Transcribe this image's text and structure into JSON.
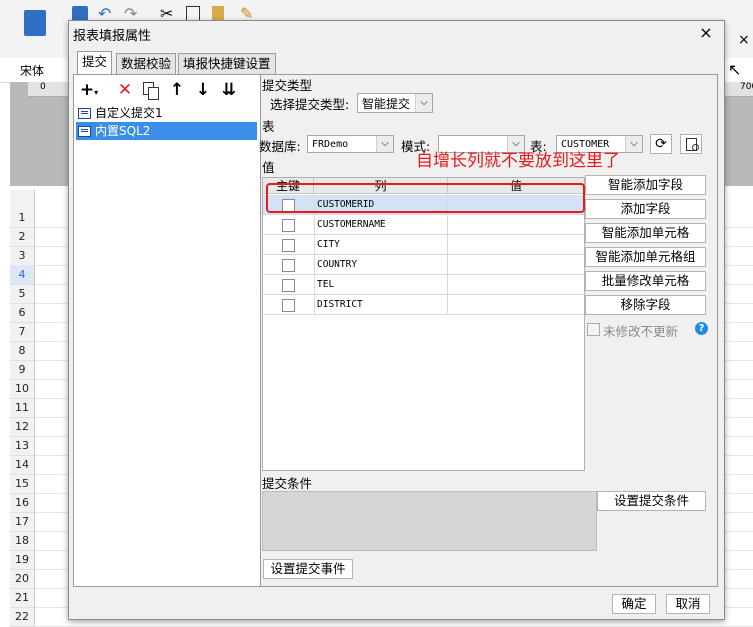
{
  "app": {
    "font_name": "宋体",
    "ruler_marks": [
      "0",
      "700"
    ],
    "row_numbers": [
      "1",
      "2",
      "3",
      "4",
      "5",
      "6",
      "7",
      "8",
      "9",
      "10",
      "11",
      "12",
      "13",
      "14",
      "15",
      "16",
      "17",
      "18",
      "19",
      "20",
      "21",
      "22"
    ],
    "selected_row": "4",
    "right_close_x": "×"
  },
  "dialog": {
    "title": "报表填报属性",
    "close_icon": "×",
    "tabs": [
      "提交",
      "数据校验",
      "填报快捷键设置"
    ],
    "active_tab": "提交",
    "left": {
      "tools": [
        "+",
        "×",
        "copy",
        "↑",
        "↓",
        "move-bottom"
      ],
      "items": [
        "自定义提交1",
        "内置SQL2"
      ],
      "selected_item": "内置SQL2"
    },
    "submit_type": {
      "section_label": "提交类型",
      "select_label": "选择提交类型:",
      "value": "智能提交"
    },
    "table_section": {
      "section_label": "表",
      "database_label": "数据库:",
      "database_value": "FRDemo",
      "schema_label": "模式:",
      "schema_value": "",
      "table_label": "表:",
      "table_value": "CUSTOMER"
    },
    "value_section": {
      "section_label": "值",
      "headers": [
        "主键",
        "列",
        "值"
      ],
      "rows": [
        {
          "column": "CUSTOMERID",
          "selected": true
        },
        {
          "column": "CUSTOMERNAME",
          "selected": false
        },
        {
          "column": "CITY",
          "selected": false
        },
        {
          "column": "COUNTRY",
          "selected": false
        },
        {
          "column": "TEL",
          "selected": false
        },
        {
          "column": "DISTRICT",
          "selected": false
        }
      ]
    },
    "side_buttons": [
      "智能添加字段",
      "添加字段",
      "智能添加单元格",
      "智能添加单元格组",
      "批量修改单元格",
      "移除字段"
    ],
    "unmodified_checkbox": "未修改不更新",
    "help_icon": "?",
    "condition": {
      "section_label": "提交条件",
      "button": "设置提交条件"
    },
    "event_button": "设置提交事件",
    "ok": "确定",
    "cancel": "取消"
  },
  "annotation": {
    "text": "自增长列就不要放到这里了",
    "color": "#e51c1c"
  }
}
